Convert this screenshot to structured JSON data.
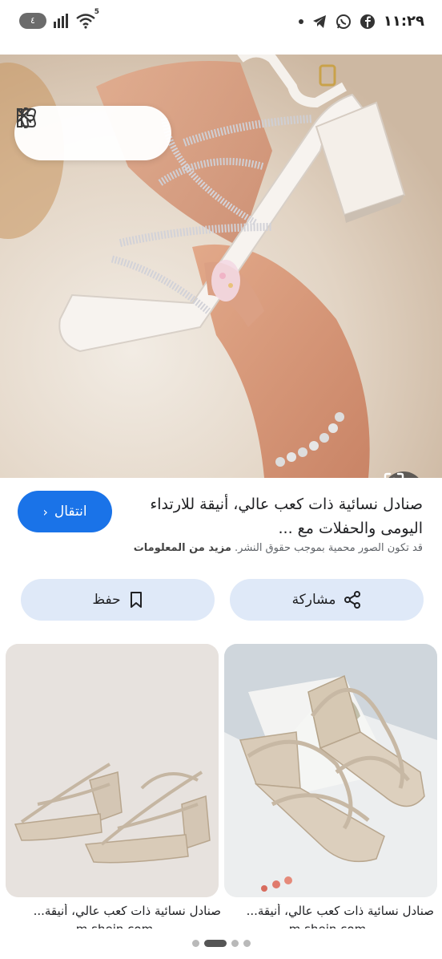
{
  "status_bar": {
    "time": "١١:٢٩",
    "battery": "٤",
    "signal_icon": "signal-bars-icon",
    "wifi_icon": "wifi-icon",
    "wifi_badge": "5"
  },
  "hero": {
    "close_icon": "close-icon",
    "dislike_icon": "thumbs-down-icon",
    "like_icon": "thumbs-up-icon",
    "lens_icon": "google-lens-icon"
  },
  "result": {
    "title": "صنادل نسائية ذات كعب عالي، أنيقة للارتداء اليومى والحفلات مع ...",
    "go_button": "انتقال",
    "copyright": "قد تكون الصور محمية بموجب حقوق النشر.",
    "more_info": "مزيد من المعلومات"
  },
  "actions": {
    "share": "مشاركة",
    "save": "حفظ"
  },
  "related": [
    {
      "caption": "صنادل نسائية ذات كعب عالي، أنيقة...",
      "source": "m.shein.com"
    },
    {
      "caption": "صنادل نسائية ذات كعب عالي، أنيقة...",
      "source": "m.shein.com"
    }
  ],
  "colors": {
    "accent": "#1a73e8",
    "action_bg": "#dfe9f8"
  }
}
